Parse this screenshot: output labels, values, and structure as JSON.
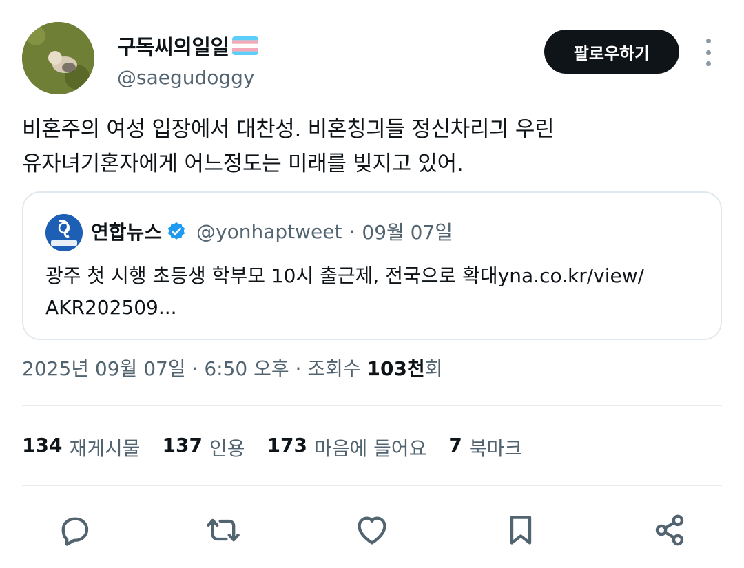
{
  "author": {
    "display_name": "구독씨의일일",
    "handle": "@saegudoggy",
    "follow_label": "팔로우하기"
  },
  "tweet": {
    "text_line1": "비혼주의 여성 입장에서 대찬성. 비혼칭긔들 정신차리긔 우린",
    "text_line2": "유자녀기혼자에게 어느정도는 미래를 빚지고 있어."
  },
  "quote": {
    "name": "연합뉴스",
    "handle": "@yonhaptweet",
    "separator": "·",
    "date": "09월 07일",
    "text_line1": "광주 첫 시행 초등생 학부모 10시 출근제, 전국으로 확대yna.co.kr/view/",
    "text_line2": "AKR202509..."
  },
  "timestamp": {
    "date": "2025년 09월 07일",
    "sep1": "·",
    "time": "6:50 오후",
    "sep2": "·",
    "views_label": "조회수",
    "views_value": "103천",
    "views_unit": "회"
  },
  "stats": [
    {
      "value": "134",
      "label": "재게시물"
    },
    {
      "value": "137",
      "label": "인용"
    },
    {
      "value": "173",
      "label": "마음에 들어요"
    },
    {
      "value": "7",
      "label": "북마크"
    }
  ],
  "icons": {
    "reply": "reply-icon",
    "retweet": "retweet-icon",
    "like": "heart-icon",
    "bookmark": "bookmark-icon",
    "share": "share-icon"
  },
  "colors": {
    "text_primary": "#0f1419",
    "text_secondary": "#536471",
    "verified_blue": "#1d9bf0",
    "button_bg": "#0f1419"
  }
}
